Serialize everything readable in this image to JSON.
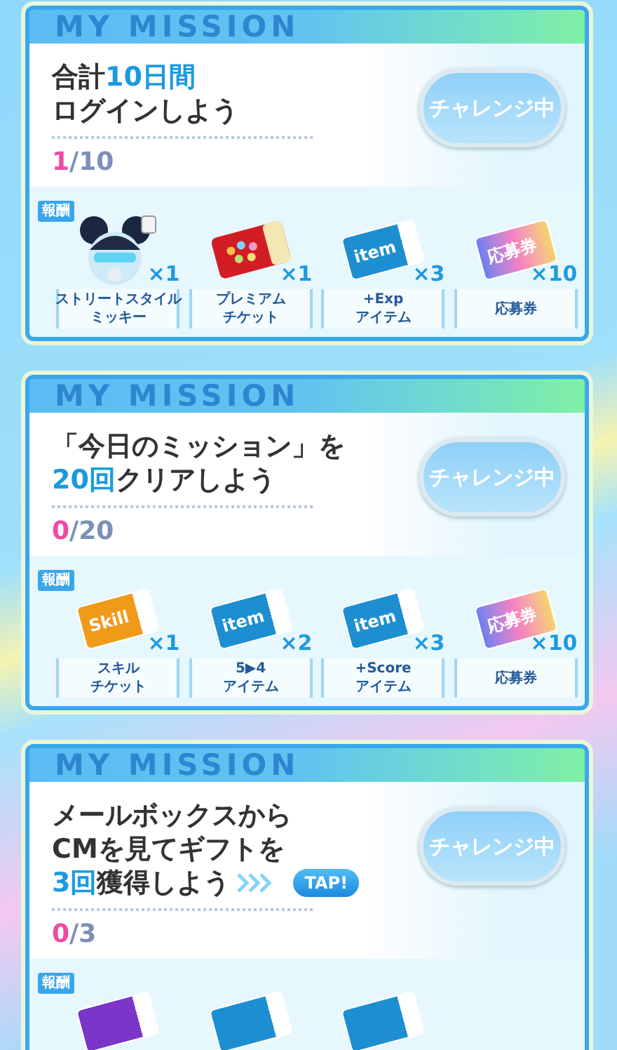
{
  "missions": [
    {
      "header_text": "MY MISSION",
      "title_lines": [
        [
          {
            "text": "合計",
            "highlight": false
          },
          {
            "text": "10日間",
            "highlight": true
          }
        ],
        [
          {
            "text": "ログインしよう",
            "highlight": false
          }
        ]
      ],
      "progress": {
        "current": "1",
        "rest": "/10"
      },
      "button": "チャレンジ中",
      "reward_tag": "報酬",
      "rewards": [
        {
          "kind": "mickey",
          "count": "×1",
          "label": [
            "ストリートスタイル",
            "ミッキー"
          ]
        },
        {
          "kind": "premium",
          "count": "×1",
          "label": [
            "プレミアム",
            "チケット"
          ]
        },
        {
          "kind": "item",
          "ticket_text": "item",
          "count": "×3",
          "label": [
            "+Exp",
            "アイテム"
          ]
        },
        {
          "kind": "entry",
          "ticket_text": "応募券",
          "count": "×10",
          "label": [
            "応募券"
          ]
        }
      ]
    },
    {
      "header_text": "MY MISSION",
      "title_lines": [
        [
          {
            "text": "「今日のミッション」を",
            "highlight": false
          }
        ],
        [
          {
            "text": "20回",
            "highlight": true
          },
          {
            "text": "クリアしよう",
            "highlight": false
          }
        ]
      ],
      "progress": {
        "current": "0",
        "rest": "/20"
      },
      "button": "チャレンジ中",
      "reward_tag": "報酬",
      "rewards": [
        {
          "kind": "skill",
          "ticket_text": "Skill",
          "count": "×1",
          "label": [
            "スキル",
            "チケット"
          ]
        },
        {
          "kind": "item",
          "ticket_text": "item",
          "count": "×2",
          "label": [
            "5▶4",
            "アイテム"
          ]
        },
        {
          "kind": "item",
          "ticket_text": "item",
          "count": "×3",
          "label": [
            "+Score",
            "アイテム"
          ]
        },
        {
          "kind": "entry",
          "ticket_text": "応募券",
          "count": "×10",
          "label": [
            "応募券"
          ]
        }
      ]
    },
    {
      "header_text": "MY MISSION",
      "title_lines": [
        [
          {
            "text": "メールボックスから",
            "highlight": false
          }
        ],
        [
          {
            "text": "CMを見てギフトを",
            "highlight": false
          }
        ],
        [
          {
            "text": "3回",
            "highlight": true
          },
          {
            "text": "獲得しよう",
            "highlight": false
          }
        ]
      ],
      "tap_button": "TAP!",
      "progress": {
        "current": "0",
        "rest": "/3"
      },
      "button": "チャレンジ中",
      "reward_tag": "報酬",
      "rewards": [
        {
          "kind": "purple"
        },
        {
          "kind": "item"
        },
        {
          "kind": "item"
        }
      ]
    }
  ]
}
